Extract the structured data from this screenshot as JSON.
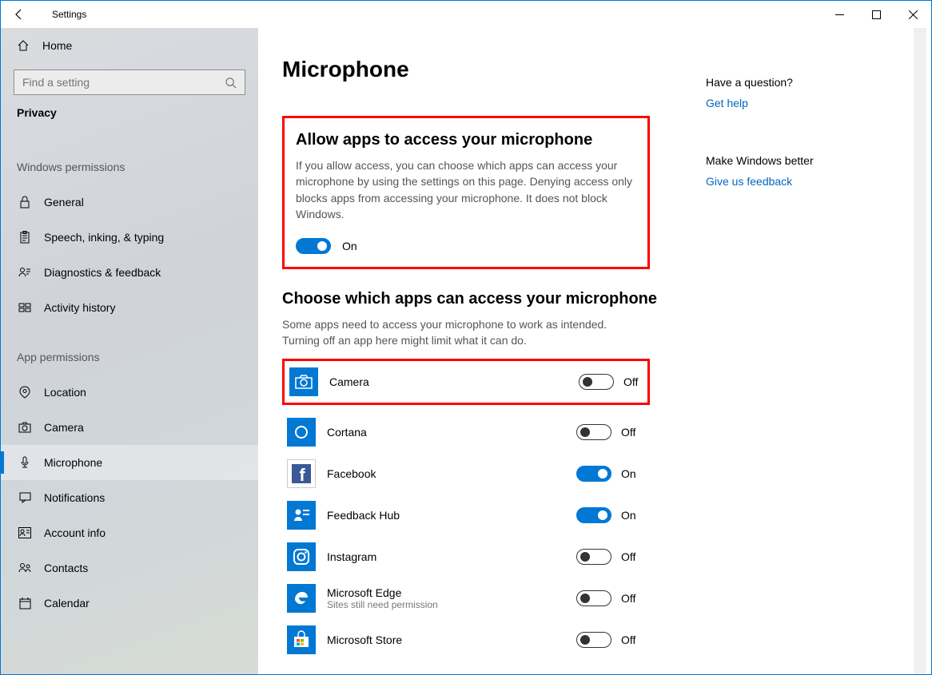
{
  "window": {
    "title": "Settings"
  },
  "sidebar": {
    "home": "Home",
    "search_placeholder": "Find a setting",
    "category": "Privacy",
    "group1_title": "Windows permissions",
    "group1": [
      {
        "label": "General"
      },
      {
        "label": "Speech, inking, & typing"
      },
      {
        "label": "Diagnostics & feedback"
      },
      {
        "label": "Activity history"
      }
    ],
    "group2_title": "App permissions",
    "group2": [
      {
        "label": "Location"
      },
      {
        "label": "Camera"
      },
      {
        "label": "Microphone"
      },
      {
        "label": "Notifications"
      },
      {
        "label": "Account info"
      },
      {
        "label": "Contacts"
      },
      {
        "label": "Calendar"
      }
    ]
  },
  "page": {
    "title": "Microphone",
    "allow_section_title": "Allow apps to access your microphone",
    "allow_section_desc": "If you allow access, you can choose which apps can access your microphone by using the settings on this page. Denying access only blocks apps from accessing your microphone. It does not block Windows.",
    "allow_toggle_state": "On",
    "choose_section_title": "Choose which apps can access your microphone",
    "choose_section_desc": "Some apps need to access your microphone to work as intended. Turning off an app here might limit what it can do.",
    "apps": [
      {
        "name": "Camera",
        "sub": "",
        "state": "Off",
        "on": false
      },
      {
        "name": "Cortana",
        "sub": "",
        "state": "Off",
        "on": false
      },
      {
        "name": "Facebook",
        "sub": "",
        "state": "On",
        "on": true
      },
      {
        "name": "Feedback Hub",
        "sub": "",
        "state": "On",
        "on": true
      },
      {
        "name": "Instagram",
        "sub": "",
        "state": "Off",
        "on": false
      },
      {
        "name": "Microsoft Edge",
        "sub": "Sites still need permission",
        "state": "Off",
        "on": false
      },
      {
        "name": "Microsoft Store",
        "sub": "",
        "state": "Off",
        "on": false
      }
    ]
  },
  "right": {
    "q_title": "Have a question?",
    "q_link": "Get help",
    "fb_title": "Make Windows better",
    "fb_link": "Give us feedback"
  }
}
